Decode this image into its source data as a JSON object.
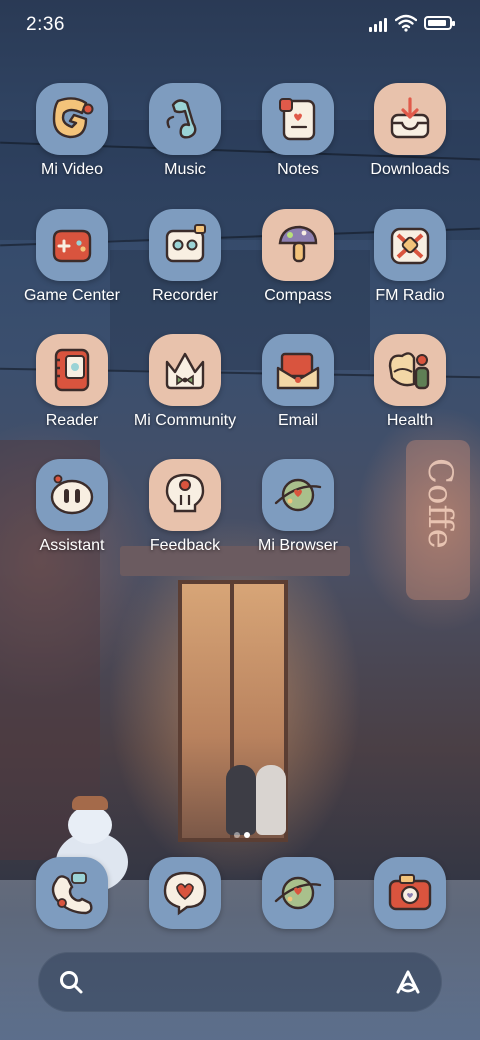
{
  "status_bar": {
    "time": "2:36",
    "battery_level": 0.9
  },
  "apps": [
    {
      "label": "Mi Video",
      "icon": "mi-video-icon",
      "color": "#7e9cbf"
    },
    {
      "label": "Music",
      "icon": "music-note-icon",
      "color": "#7e9cbf"
    },
    {
      "label": "Notes",
      "icon": "notes-icon",
      "color": "#7e9cbf"
    },
    {
      "label": "Downloads",
      "icon": "download-tray-icon",
      "color": "#e8c2ac"
    },
    {
      "label": "Game Center",
      "icon": "gamepad-icon",
      "color": "#7e9cbf"
    },
    {
      "label": "Recorder",
      "icon": "cassette-icon",
      "color": "#7e9cbf"
    },
    {
      "label": "Compass",
      "icon": "mushroom-compass-icon",
      "color": "#e8c2ac"
    },
    {
      "label": "FM Radio",
      "icon": "radio-icon",
      "color": "#7e9cbf"
    },
    {
      "label": "Reader",
      "icon": "book-icon",
      "color": "#e8c2ac"
    },
    {
      "label": "Mi Community",
      "icon": "crown-icon",
      "color": "#e8c2ac"
    },
    {
      "label": "Email",
      "icon": "envelope-icon",
      "color": "#7e9cbf"
    },
    {
      "label": "Health",
      "icon": "heart-bottle-icon",
      "color": "#e8c2ac"
    },
    {
      "label": "Assistant",
      "icon": "assistant-face-icon",
      "color": "#7e9cbf"
    },
    {
      "label": "Feedback",
      "icon": "lightbulb-icon",
      "color": "#e8c2ac"
    },
    {
      "label": "Mi Browser",
      "icon": "planet-icon",
      "color": "#7e9cbf"
    }
  ],
  "dock": [
    {
      "icon": "phone-icon",
      "color": "#7e9cbf"
    },
    {
      "icon": "message-heart-icon",
      "color": "#7e9cbf"
    },
    {
      "icon": "planet-icon",
      "color": "#7e9cbf"
    },
    {
      "icon": "camera-icon",
      "color": "#7e9cbf"
    }
  ],
  "page_indicator": {
    "pages": 2,
    "current": 2
  },
  "search_bar": {
    "left_icon": "search-icon",
    "right_icon": "assistant-a-icon"
  },
  "wallpaper": {
    "sign_text": "Coffe"
  }
}
